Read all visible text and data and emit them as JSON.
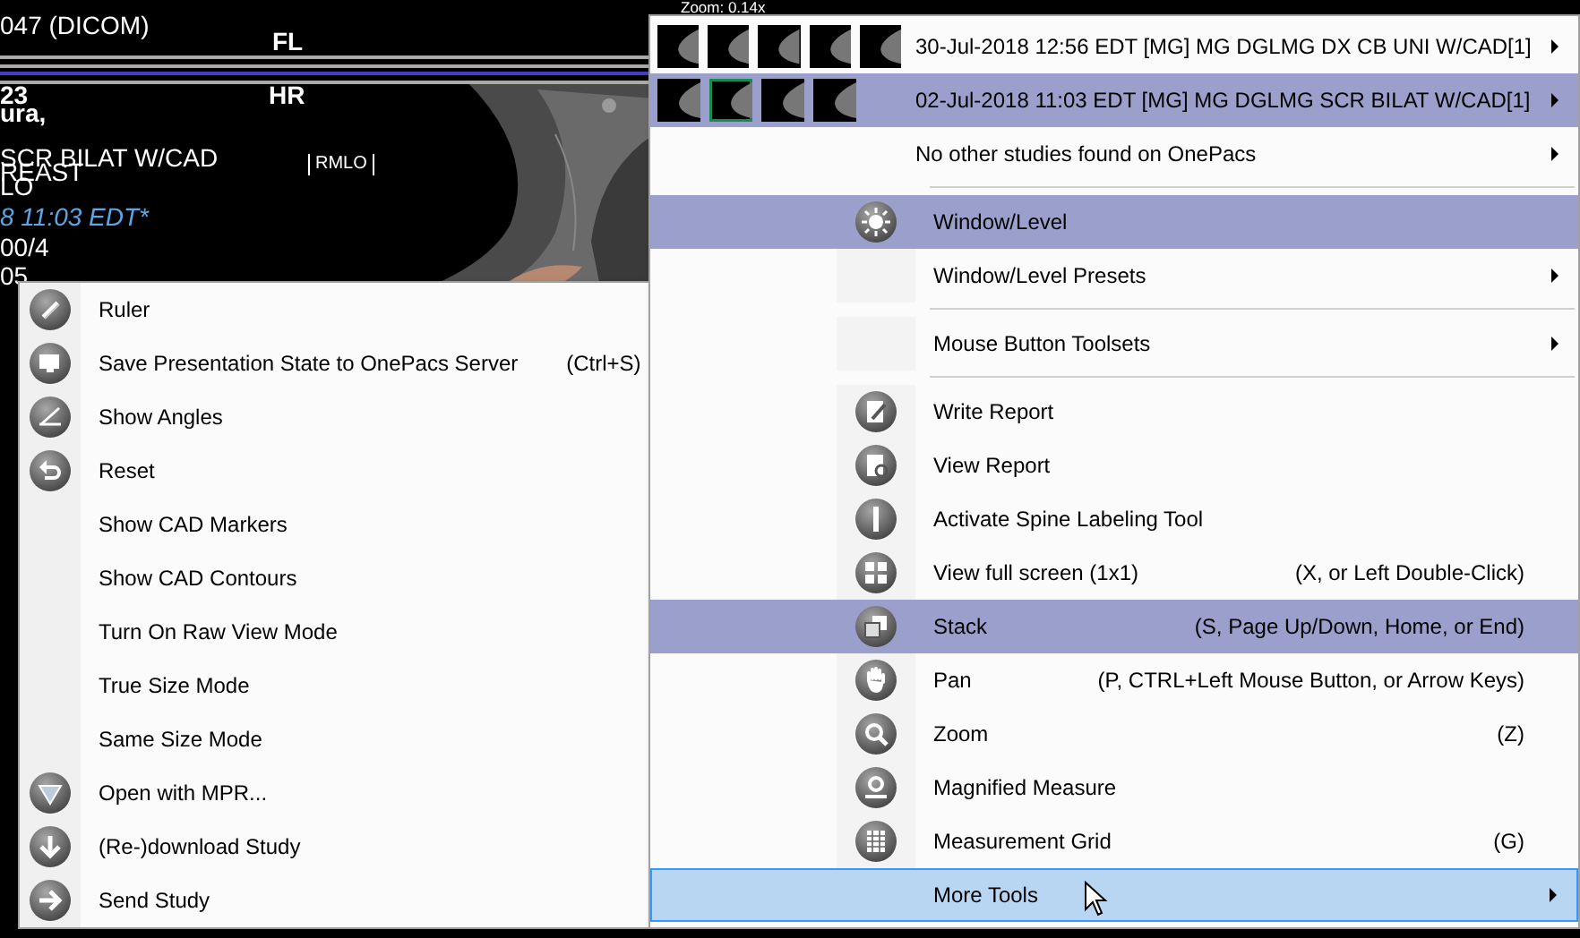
{
  "viewer": {
    "overlay_texts": [
      {
        "text": "047 (DICOM)",
        "kind": "plain"
      },
      {
        "text": "FL",
        "kind": "bold"
      },
      {
        "text": "23",
        "kind": "bold"
      },
      {
        "text": "ura,",
        "kind": "bold"
      },
      {
        "text": "HR",
        "kind": "bold"
      },
      {
        "text": "SCR BILAT W/CAD",
        "kind": "plain"
      },
      {
        "text": "REAST",
        "kind": "plain"
      },
      {
        "text": "LO",
        "kind": "plain"
      },
      {
        "text": "RMLO",
        "kind": "marker"
      },
      {
        "text": "8 11:03 EDT*",
        "kind": "date"
      },
      {
        "text": "00/4",
        "kind": "plain"
      },
      {
        "text": "05",
        "kind": "plain"
      },
      {
        "text": "Zoom: 0.14x",
        "kind": "small"
      }
    ]
  },
  "left_menu": {
    "items": [
      {
        "label": "Ruler"
      },
      {
        "label": "Save Presentation State to OnePacs Server",
        "shortcut": "(Ctrl+S)"
      },
      {
        "label": "Show Angles"
      },
      {
        "label": "Reset"
      },
      {
        "label": "Show CAD Markers"
      },
      {
        "label": "Show CAD Contours"
      },
      {
        "label": "Turn On Raw View Mode"
      },
      {
        "label": "True Size Mode"
      },
      {
        "label": "Same Size Mode"
      },
      {
        "label": "Open with MPR..."
      },
      {
        "label": "(Re-)download Study"
      },
      {
        "label": "Send Study"
      }
    ]
  },
  "right_menu": {
    "studies": [
      {
        "label": "30-Jul-2018 12:56 EDT [MG] MG DGLMG DX CB UNI W/CAD[1]",
        "selected": false,
        "submenu": true,
        "thumbnails": [
          {
            "selected": false
          },
          {
            "selected": false
          },
          {
            "selected": false
          },
          {
            "selected": false
          },
          {
            "selected": false
          }
        ]
      },
      {
        "label": "02-Jul-2018 11:03 EDT [MG] MG DGLMG SCR BILAT W/CAD[1]",
        "selected": true,
        "submenu": true,
        "thumbnails": [
          {
            "selected": false
          },
          {
            "selected": true
          },
          {
            "selected": false
          },
          {
            "selected": false
          }
        ]
      },
      {
        "label": "No other studies found on OnePacs",
        "selected": false,
        "submenu": true
      }
    ],
    "groups": [
      [
        {
          "label": "Window/Level",
          "selected": true,
          "hovered": false,
          "submenu": false
        },
        {
          "label": "Window/Level Presets",
          "selected": false,
          "hovered": false,
          "submenu": true
        }
      ],
      [
        {
          "label": "Mouse Button Toolsets",
          "selected": false,
          "hovered": false,
          "submenu": true
        }
      ],
      [
        {
          "label": "Write Report",
          "selected": false,
          "hovered": false,
          "submenu": false
        },
        {
          "label": "View Report",
          "selected": false,
          "hovered": false,
          "submenu": false
        },
        {
          "label": "Activate Spine Labeling Tool",
          "selected": false,
          "hovered": false,
          "submenu": false
        },
        {
          "label": "View full screen (1x1)",
          "shortcut": "(X, or Left Double-Click)",
          "selected": false,
          "hovered": false,
          "submenu": false
        },
        {
          "label": "Stack",
          "shortcut": "(S, Page Up/Down, Home, or End)",
          "selected": true,
          "hovered": false,
          "submenu": false
        },
        {
          "label": "Pan",
          "shortcut": "(P, CTRL+Left Mouse Button, or Arrow Keys)",
          "selected": false,
          "hovered": false,
          "submenu": false
        },
        {
          "label": "Zoom",
          "shortcut": "(Z)",
          "selected": false,
          "hovered": false,
          "submenu": false
        },
        {
          "label": "Magnified Measure",
          "selected": false,
          "hovered": false,
          "submenu": false
        },
        {
          "label": "Measurement Grid",
          "shortcut": "(G)",
          "selected": false,
          "hovered": false,
          "submenu": false
        },
        {
          "label": "More Tools",
          "selected": false,
          "hovered": true,
          "submenu": true
        }
      ]
    ]
  }
}
